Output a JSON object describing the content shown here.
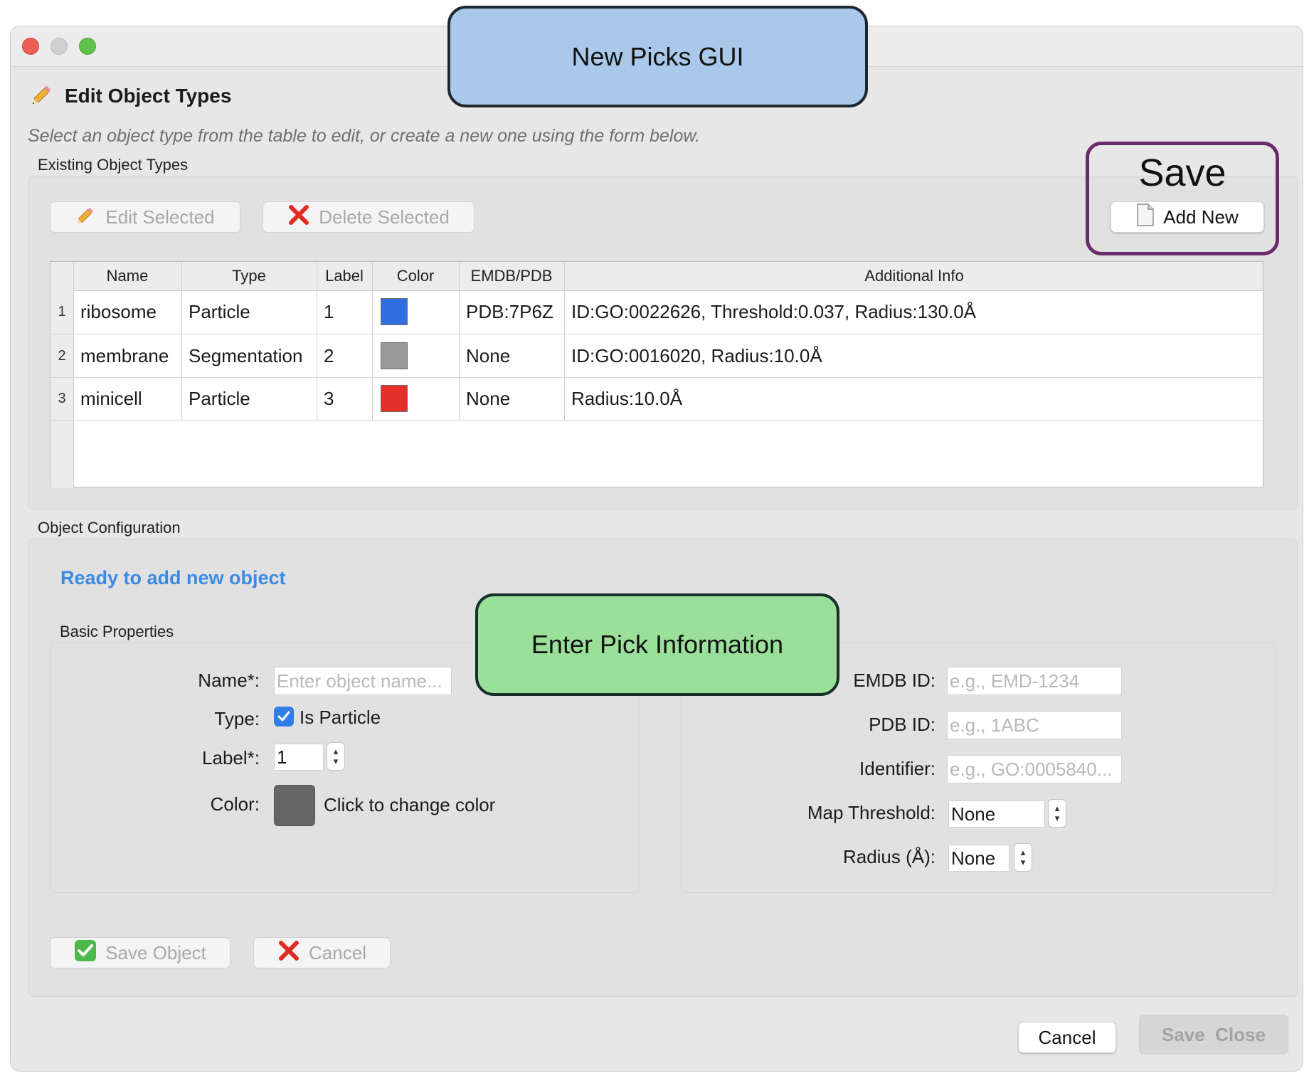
{
  "window": {
    "title": "Edit Object Types",
    "subtitle": "Select an object type from the table to edit, or create a new one using the form below."
  },
  "existing": {
    "group_label": "Existing Object Types",
    "edit_selected": "Edit Selected",
    "delete_selected": "Delete Selected",
    "add_new": "Add New"
  },
  "table": {
    "columns": [
      "Name",
      "Type",
      "Label",
      "Color",
      "EMDB/PDB",
      "Additional Info"
    ],
    "rows": [
      {
        "num": "1",
        "name": "ribosome",
        "type": "Particle",
        "label": "1",
        "color": "#2f6fdf",
        "emdb_pdb": "PDB:7P6Z",
        "info": "ID:GO:0022626, Threshold:0.037, Radius:130.0Å"
      },
      {
        "num": "2",
        "name": "membrane",
        "type": "Segmentation",
        "label": "2",
        "color": "#9a9a9a",
        "emdb_pdb": "None",
        "info": "ID:GO:0016020, Radius:10.0Å"
      },
      {
        "num": "3",
        "name": "minicell",
        "type": "Particle",
        "label": "3",
        "color": "#e5302a",
        "emdb_pdb": "None",
        "info": "Radius:10.0Å"
      }
    ]
  },
  "config": {
    "group_label": "Object Configuration",
    "status": "Ready to add new object",
    "basic_label": "Basic Properties",
    "name_label": "Name*:",
    "name_placeholder": "Enter object name...",
    "type_label": "Type:",
    "is_particle": "Is Particle",
    "is_particle_checked": true,
    "label_label": "Label*:",
    "label_value": "1",
    "color_label": "Color:",
    "color_value": "#666666",
    "color_hint": "Click to change color",
    "emdb_label": "EMDB ID:",
    "emdb_placeholder": "e.g., EMD-1234",
    "pdb_label": "PDB ID:",
    "pdb_placeholder": "e.g., 1ABC",
    "identifier_label": "Identifier:",
    "identifier_placeholder": "e.g., GO:0005840...",
    "threshold_label": "Map Threshold:",
    "threshold_value": "None",
    "radius_label": "Radius (Å):",
    "radius_value": "None",
    "save_object": "Save Object",
    "cancel": "Cancel"
  },
  "footer": {
    "cancel": "Cancel",
    "save_close": "Save  Close"
  },
  "callouts": {
    "top": "New Picks GUI",
    "save": "Save",
    "middle": "Enter Pick Information"
  },
  "colors": {
    "callout_top": "#a9c8ea",
    "callout_middle": "#9ae09a",
    "save_border": "#6a2b6a",
    "status_blue": "#3b8be6"
  }
}
